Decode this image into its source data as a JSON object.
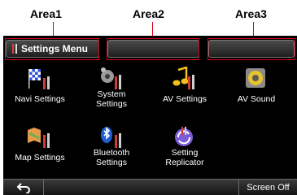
{
  "callouts": {
    "area1": "Area1",
    "area2": "Area2",
    "area3": "Area3"
  },
  "header": {
    "title": "Settings Menu",
    "area2_content": "",
    "area3_content": ""
  },
  "menu": {
    "items": [
      {
        "label_line1": "Navi Settings",
        "label_line2": "",
        "icon": "navi-settings-icon"
      },
      {
        "label_line1": "System",
        "label_line2": "Settings",
        "icon": "system-settings-icon"
      },
      {
        "label_line1": "AV Settings",
        "label_line2": "",
        "icon": "av-settings-icon"
      },
      {
        "label_line1": "AV Sound",
        "label_line2": "",
        "icon": "av-sound-icon"
      },
      {
        "label_line1": "Map Settings",
        "label_line2": "",
        "icon": "map-settings-icon"
      },
      {
        "label_line1": "Bluetooth",
        "label_line2": "Settings",
        "icon": "bluetooth-settings-icon"
      },
      {
        "label_line1": "Setting",
        "label_line2": "Replicator",
        "icon": "setting-replicator-icon"
      }
    ]
  },
  "bottom_bar": {
    "back_icon": "back-arrow-icon",
    "screen_off_label": "Screen Off"
  },
  "colors": {
    "callout": "#d9001b",
    "screen_bg": "#000000",
    "text": "#ffffff"
  }
}
